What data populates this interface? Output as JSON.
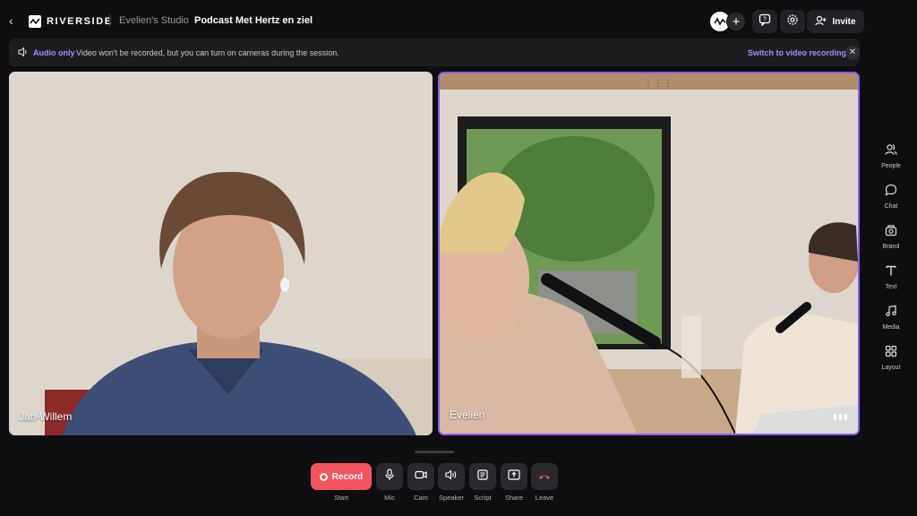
{
  "topbar": {
    "brand": "RIVERSIDE",
    "studio": "Evelien's Studio",
    "session_title": "Podcast Met Hertz en ziel",
    "invite_label": "Invite"
  },
  "banner": {
    "mode": "Audio only",
    "message": "Video won't be recorded, but you can turn on cameras during the session.",
    "switch_label": "Switch to video recording"
  },
  "participants": [
    {
      "name": "Jan-Willem"
    },
    {
      "name": "Evelien"
    }
  ],
  "sidebar": {
    "items": [
      {
        "label": "People",
        "icon": "people-icon"
      },
      {
        "label": "Chat",
        "icon": "chat-icon"
      },
      {
        "label": "Brand",
        "icon": "brand-icon"
      },
      {
        "label": "Text",
        "icon": "text-icon"
      },
      {
        "label": "Media",
        "icon": "media-icon"
      },
      {
        "label": "Layout",
        "icon": "layout-icon"
      }
    ]
  },
  "controls": {
    "record_label": "Record",
    "start_label": "Start",
    "mic": "Mic",
    "cam": "Cam",
    "speaker": "Speaker",
    "script": "Script",
    "share": "Share",
    "leave": "Leave"
  },
  "colors": {
    "accent": "#a38bff",
    "record": "#f2545f",
    "active_border": "#8a5cf6",
    "background": "#0e0e10"
  }
}
